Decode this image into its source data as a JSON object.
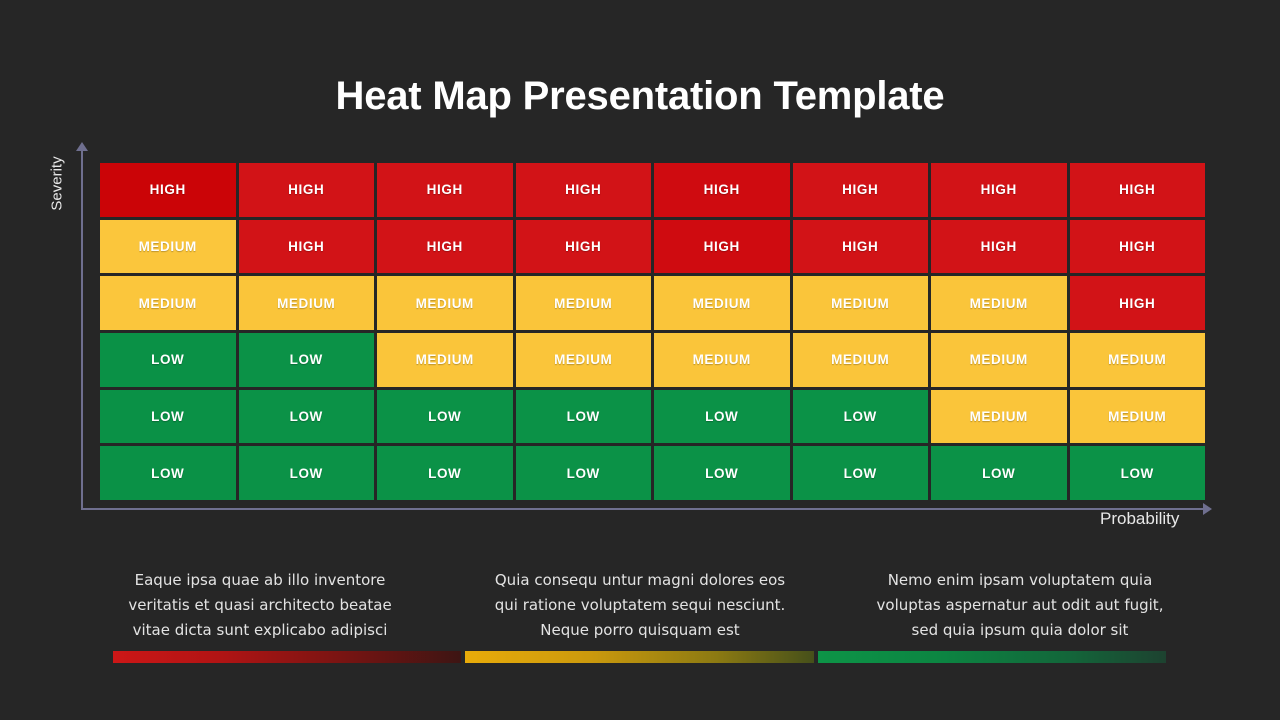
{
  "title": "Heat Map Presentation Template",
  "axes": {
    "y_label": "Severity",
    "x_label": "Probability"
  },
  "colors": {
    "background": "#262626",
    "high": "#d21317",
    "medium": "#fac53a",
    "low": "#0b9247",
    "axis": "#6f6f8f",
    "title_text": "#ffffff",
    "body_text": "#e3e3e3"
  },
  "descriptions": [
    "Eaque ipsa quae ab illo inventore veritatis et quasi architecto beatae vitae dicta sunt explicabo adipisci",
    "Quia consequ untur magni dolores eos qui ratione voluptatem sequi nesciunt. Neque porro quisquam est",
    "Nemo enim ipsam voluptatem quia voluptas aspernatur aut odit aut fugit, sed quia ipsum quia dolor sit"
  ],
  "legend_bars": [
    {
      "name": "high-gradient-bar",
      "from": "#cc1717",
      "to": "#3d1513"
    },
    {
      "name": "medium-gradient-bar",
      "from": "#e8ab0a",
      "to": "#46501a"
    },
    {
      "name": "low-gradient-bar",
      "from": "#0d9447",
      "to": "#1d4230"
    }
  ],
  "chart_data": {
    "type": "heatmap",
    "title": "Heat Map Presentation Template",
    "xlabel": "Probability",
    "ylabel": "Severity",
    "columns": 8,
    "rows": 6,
    "levels": [
      "HIGH",
      "MEDIUM",
      "LOW"
    ],
    "level_colors": {
      "HIGH": "#d21317",
      "MEDIUM": "#fac53a",
      "LOW": "#0b9247"
    },
    "grid": [
      [
        "HIGH",
        "HIGH",
        "HIGH",
        "HIGH",
        "HIGH",
        "HIGH",
        "HIGH",
        "HIGH"
      ],
      [
        "MEDIUM",
        "HIGH",
        "HIGH",
        "HIGH",
        "HIGH",
        "HIGH",
        "HIGH",
        "HIGH"
      ],
      [
        "MEDIUM",
        "MEDIUM",
        "MEDIUM",
        "MEDIUM",
        "MEDIUM",
        "MEDIUM",
        "MEDIUM",
        "HIGH"
      ],
      [
        "LOW",
        "LOW",
        "MEDIUM",
        "MEDIUM",
        "MEDIUM",
        "MEDIUM",
        "MEDIUM",
        "MEDIUM"
      ],
      [
        "LOW",
        "LOW",
        "LOW",
        "LOW",
        "LOW",
        "LOW",
        "MEDIUM",
        "MEDIUM"
      ],
      [
        "LOW",
        "LOW",
        "LOW",
        "LOW",
        "LOW",
        "LOW",
        "LOW",
        "LOW"
      ]
    ]
  }
}
